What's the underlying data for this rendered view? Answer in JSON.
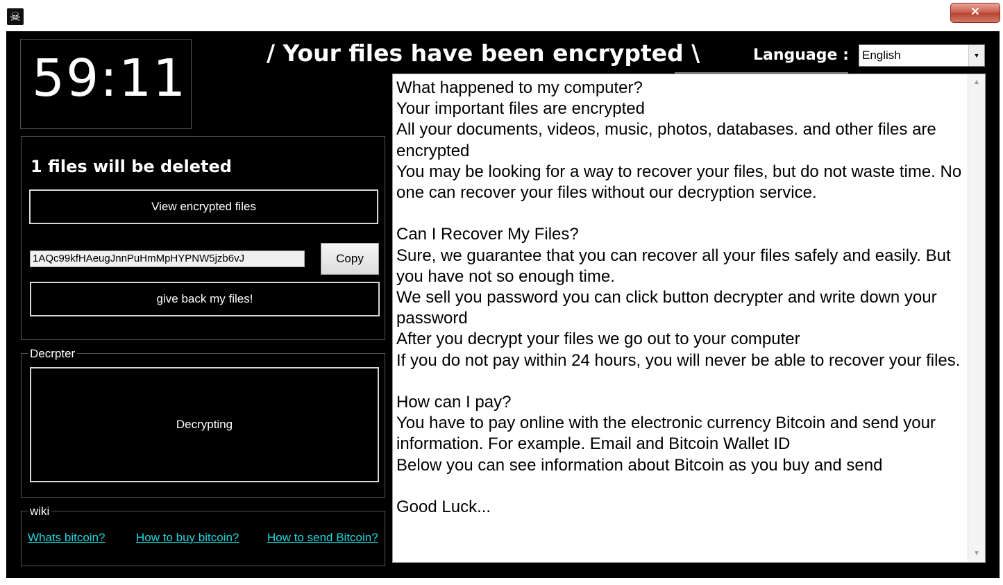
{
  "titlebar": {
    "close_glyph": "✕",
    "app_icon": "☠"
  },
  "timer": "59:11",
  "headline": "/ Your files have been encrypted \\",
  "language": {
    "label": "Language :",
    "selected": "English",
    "arrow": "▼"
  },
  "status": {
    "files_deleted": "1 files will be deleted",
    "view_button": "View encrypted files",
    "wallet_address": "1AQc99kfHAeugJnnPuHmMpHYPNW5jzb6vJ",
    "copy_button": "Copy",
    "give_back_button": "give back my files!"
  },
  "decrypter": {
    "legend": "Decrpter",
    "button": "Decrypting"
  },
  "wiki": {
    "legend": "wiki",
    "links": [
      "Whats bitcoin?",
      "How to buy bitcoin?",
      "How to send Bitcoin?"
    ]
  },
  "message_lines": [
    "What happened to my computer?",
    "Your important files are encrypted",
    "All your documents, videos, music, photos, databases. and other files are",
    "encrypted",
    "You may be looking for a way to recover your files, but do not waste time. No",
    "one can recover your files without our decryption service.",
    "",
    "Can I Recover My Files?",
    "Sure, we guarantee that you can recover all your files safely and easily. But",
    "you have not so enough time.",
    "We sell you password you can click button decrypter and write down your",
    "password",
    "After you decrypt your files we go out to your computer",
    "If you do not pay within 24 hours, you will never be able to recover your files.",
    "",
    "How can I pay?",
    "You have to pay online with the electronic currency Bitcoin and send your",
    "information. For example. Email and Bitcoin Wallet ID",
    "Below you can see information about Bitcoin as you buy and send",
    "",
    "Good Luck..."
  ],
  "scrollbar": {
    "up": "▲",
    "down": "▼"
  }
}
